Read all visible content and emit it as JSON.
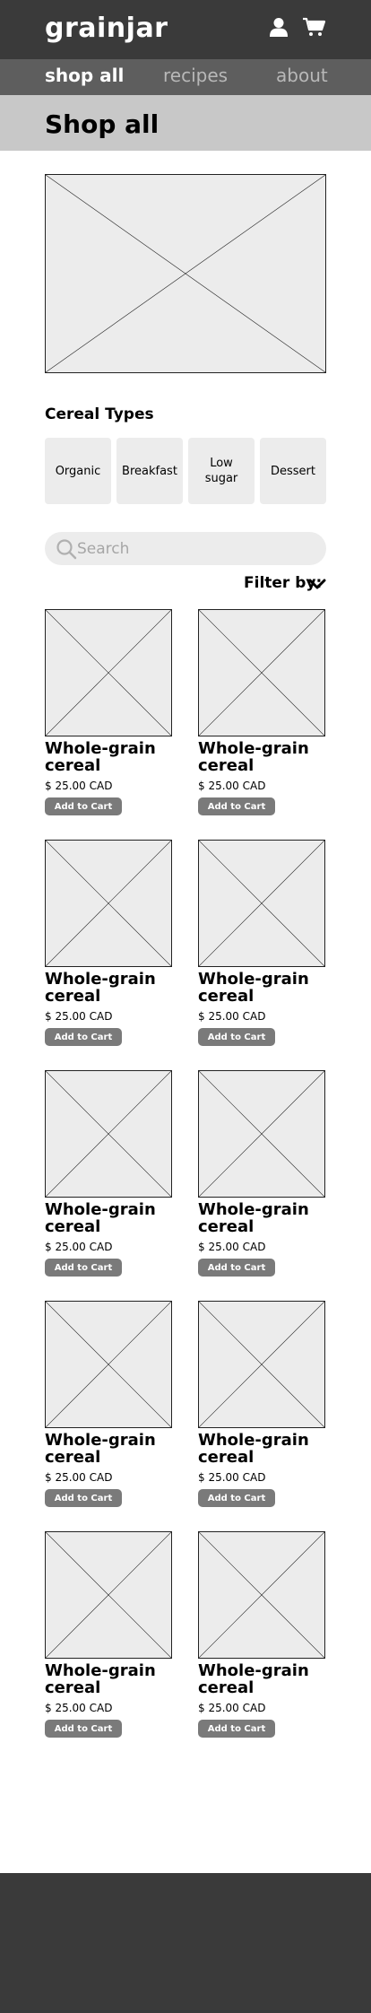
{
  "header": {
    "logo_text": "grainjar",
    "icons": [
      "user-icon",
      "cart-icon"
    ]
  },
  "nav": {
    "items": [
      {
        "label": "shop all",
        "active": true
      },
      {
        "label": "recipes",
        "active": false
      },
      {
        "label": "about",
        "active": false
      }
    ]
  },
  "page": {
    "title": "Shop all"
  },
  "cereal_types": {
    "title": "Cereal Types",
    "items": [
      "Organic",
      "Breakfast",
      "Low sugar",
      "Dessert"
    ]
  },
  "search": {
    "placeholder": "Search"
  },
  "filter": {
    "label": "Filter by:"
  },
  "products": [
    {
      "name": "Whole-grain cereal",
      "price": "$ 25.00 CAD",
      "button": "Add to Cart"
    },
    {
      "name": "Whole-grain cereal",
      "price": "$ 25.00 CAD",
      "button": "Add to Cart"
    },
    {
      "name": "Whole-grain cereal",
      "price": "$ 25.00 CAD",
      "button": "Add to Cart"
    },
    {
      "name": "Whole-grain cereal",
      "price": "$ 25.00 CAD",
      "button": "Add to Cart"
    },
    {
      "name": "Whole-grain cereal",
      "price": "$ 25.00 CAD",
      "button": "Add to Cart"
    },
    {
      "name": "Whole-grain cereal",
      "price": "$ 25.00 CAD",
      "button": "Add to Cart"
    },
    {
      "name": "Whole-grain cereal",
      "price": "$ 25.00 CAD",
      "button": "Add to Cart"
    },
    {
      "name": "Whole-grain cereal",
      "price": "$ 25.00 CAD",
      "button": "Add to Cart"
    },
    {
      "name": "Whole-grain cereal",
      "price": "$ 25.00 CAD",
      "button": "Add to Cart"
    },
    {
      "name": "Whole-grain cereal",
      "price": "$ 25.00 CAD",
      "button": "Add to Cart"
    }
  ],
  "colors": {
    "header_bg": "#3a3a3a",
    "nav_bg": "#5e5e5e",
    "title_bg": "#c8c8c8",
    "placeholder_bg": "#ececec",
    "button_bg": "#7a7a7a"
  }
}
